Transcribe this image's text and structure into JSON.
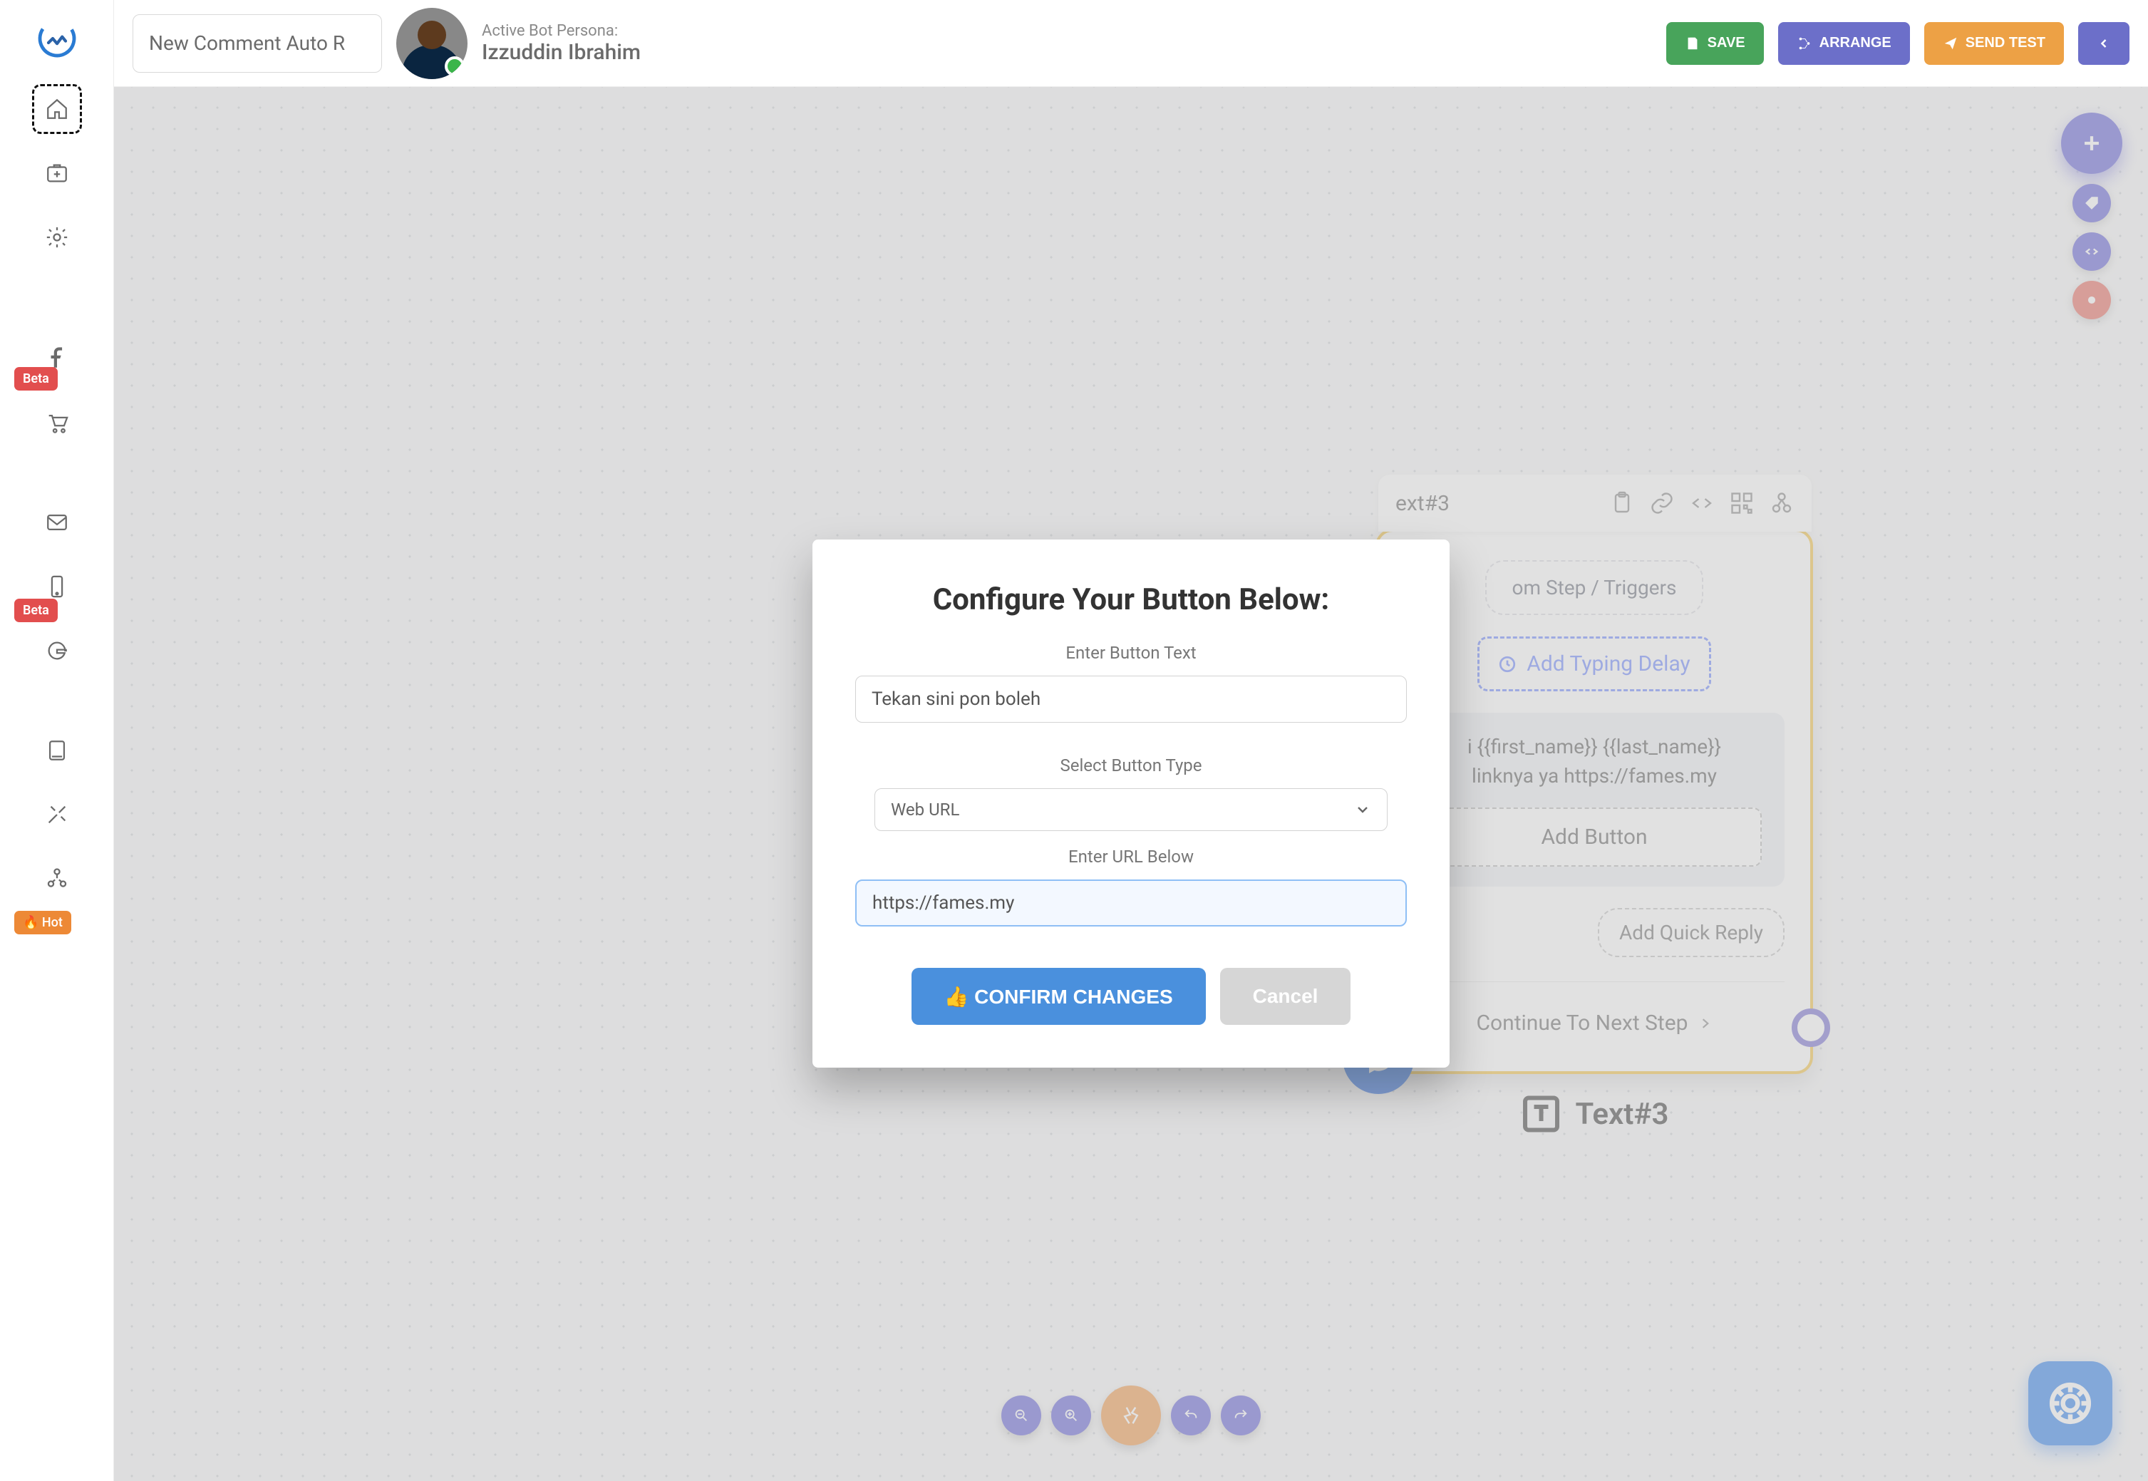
{
  "sidebar": {
    "badges": {
      "beta1": "Beta",
      "beta2": "Beta",
      "hot": "🔥 Hot"
    }
  },
  "topbar": {
    "flow_name": "New Comment Auto R",
    "persona_label": "Active Bot Persona:",
    "persona_name": "Izzuddin Ibrahim",
    "save": "SAVE",
    "arrange": "ARRANGE",
    "send_test": "SEND TEST"
  },
  "card": {
    "header_title": "ext#3",
    "trigger_pill": "om Step / Triggers",
    "typing_delay": "Add Typing Delay",
    "msg_line1": "i {{first_name}} {{last_name}}",
    "msg_line2": "linknya ya https://fames.my",
    "add_button": "Add Button",
    "add_quick_reply": "Add Quick Reply",
    "continue": "Continue To Next Step",
    "footer_label": "Text#3"
  },
  "modal": {
    "title": "Configure Your Button Below:",
    "label_text": "Enter Button Text",
    "button_text_value": "Tekan sini pon boleh",
    "label_type": "Select Button Type",
    "type_value": "Web URL",
    "label_url": "Enter URL Below",
    "url_value": "https://fames.my",
    "confirm": "👍 CONFIRM CHANGES",
    "cancel": "Cancel"
  }
}
